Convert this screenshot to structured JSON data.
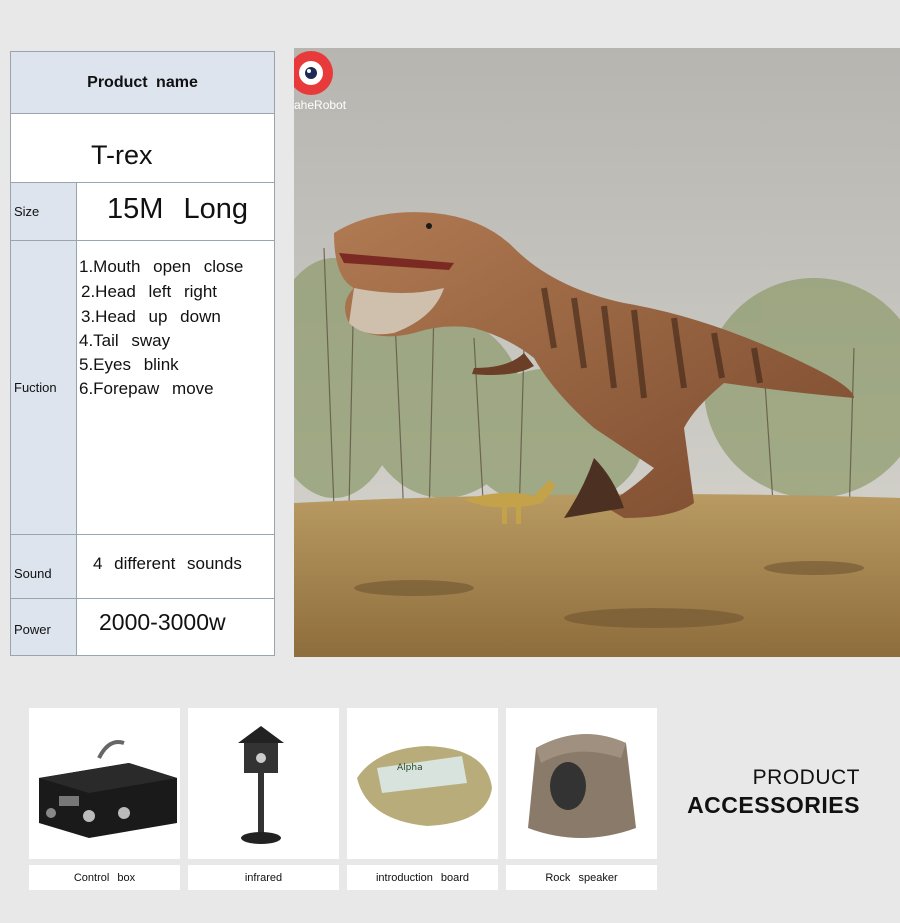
{
  "spec": {
    "header": "Product name",
    "name": "T-rex",
    "size_label": "Size",
    "size_value": "15M Long",
    "function_label": "Fuction",
    "functions": [
      "1.Mouth open close",
      "2.Head left right",
      "3.Head up down",
      "4.Tail sway",
      "5.Eyes blink",
      "6.Forepaw move"
    ],
    "sound_label": "Sound",
    "sound_value": "4 different sounds",
    "power_label": "Power",
    "power_value": "2000-3000w"
  },
  "photo": {
    "brand_text": "aheRobot",
    "subject": "T-rex animatronic in field"
  },
  "accessories": {
    "heading_line1": "PRODUCT",
    "heading_line2": "ACCESSORIES",
    "items": [
      {
        "label": "Control box",
        "icon": "control-box-icon"
      },
      {
        "label": "infrared",
        "icon": "infrared-sensor-icon"
      },
      {
        "label": "introduction board",
        "icon": "introduction-board-icon"
      },
      {
        "label": "Rock speaker",
        "icon": "rock-speaker-icon"
      }
    ]
  },
  "colors": {
    "page_bg": "#e8e8e8",
    "table_label_bg": "#dde4ee",
    "table_border": "#9aa3b0",
    "brand_red": "#e83a3a"
  }
}
